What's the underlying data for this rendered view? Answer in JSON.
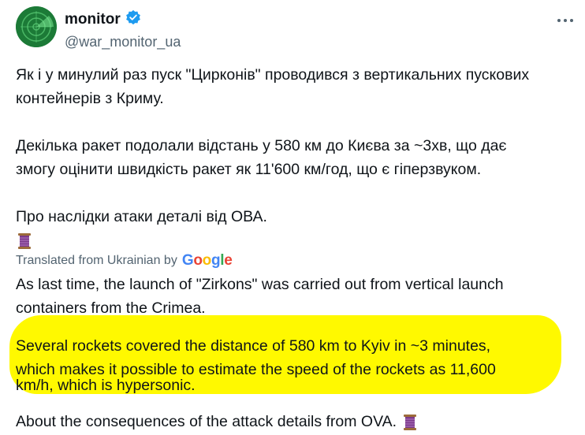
{
  "author": {
    "display_name": "monitor",
    "handle": "@war_monitor_ua",
    "verified": true
  },
  "original_text": {
    "p1_l1": "Як і у минулий раз пуск \"Цирконів\" проводився з вертикальних пускових",
    "p1_l2": "контейнерів з Криму.",
    "p2_l1": "Декілька ракет подолали відстань у 580 км до Києва за ~3хв, що дає",
    "p2_l2": "змогу оцінити швидкість ракет як 11'600 км/год, що є гіперзвуком.",
    "p3_l1": "Про наслідки атаки деталі від ОВА."
  },
  "translation": {
    "label": "Translated from Ukrainian by",
    "provider": "Google",
    "p1_l1": "As last time, the launch of \"Zirkons\" was carried out from vertical launch",
    "p1_l2": "containers from the Crimea.",
    "p2_l1": "Several rockets covered the distance of 580 km to Kyiv in ~3 minutes,",
    "p2_l2": "which makes it possible to estimate the speed of the rockets as 11,600",
    "p2_l3": "km/h, which is hypersonic.",
    "p3_l1": "About the consequences of the attack details from OVA."
  },
  "colors": {
    "highlight": "#fff900",
    "verified": "#1d9bf0",
    "spool": "#7a3a8a"
  },
  "icons": [
    "verified-badge-icon",
    "more-icon",
    "thread-spool-emoji",
    "google-logo"
  ]
}
